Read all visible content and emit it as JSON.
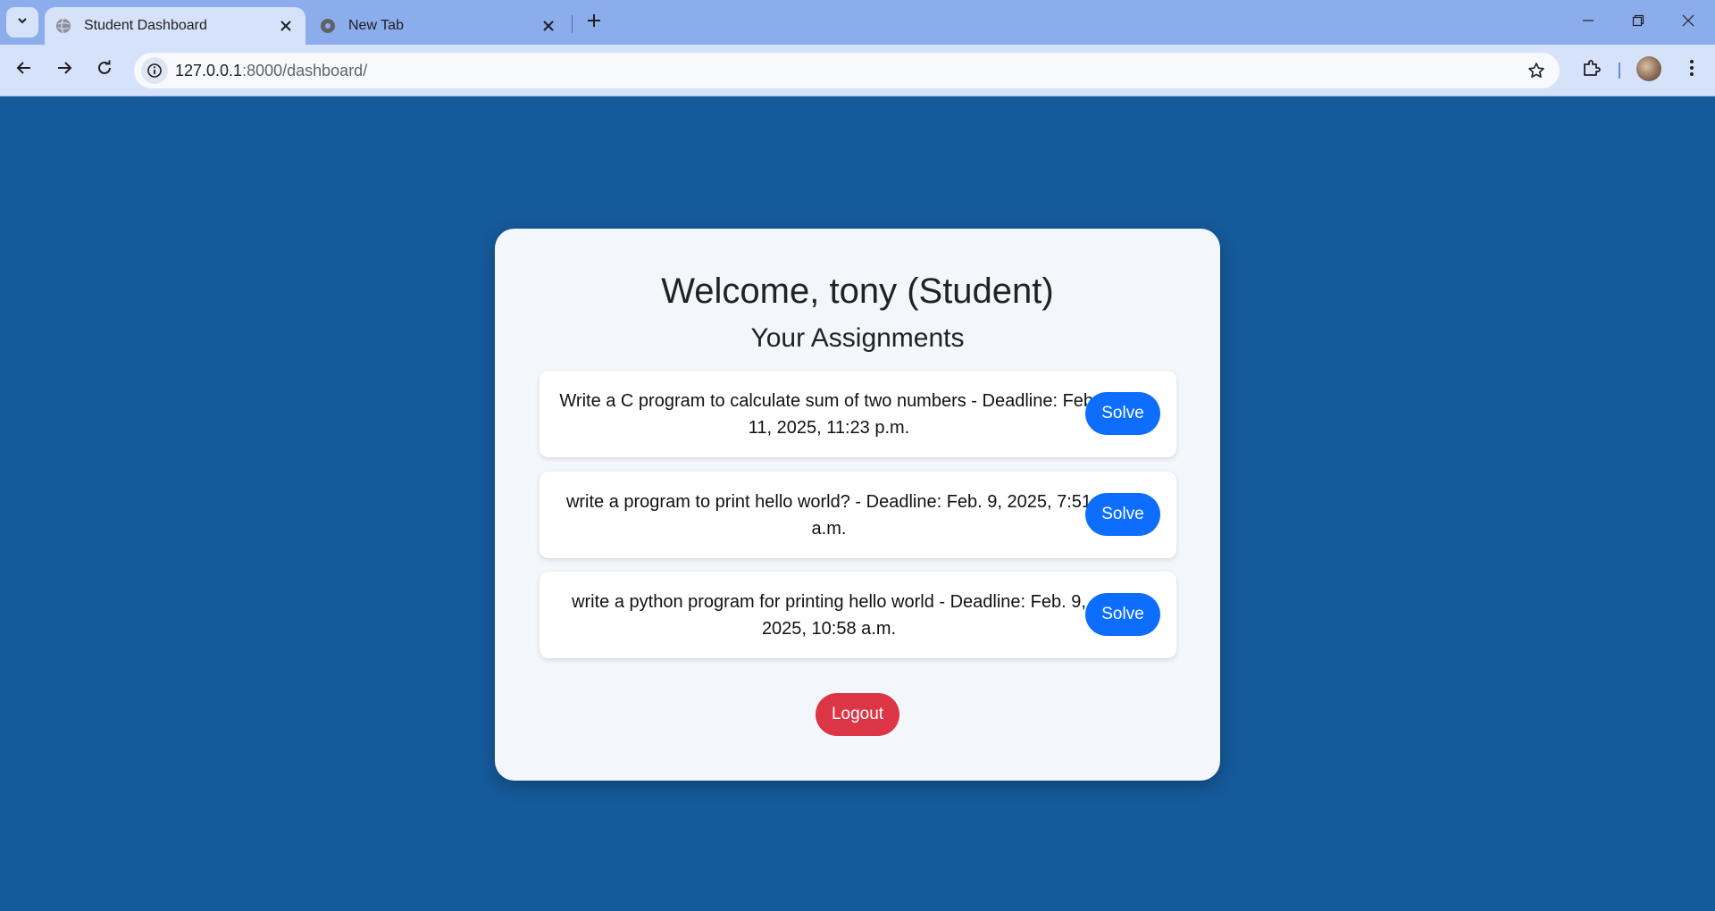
{
  "browser": {
    "tabs": [
      {
        "title": "Student Dashboard",
        "favicon": "globe-icon",
        "active": true
      },
      {
        "title": "New Tab",
        "favicon": "chrome-icon",
        "active": false
      }
    ],
    "url_host": "127.0.0.1",
    "url_rest": ":8000/dashboard/"
  },
  "page": {
    "welcome": "Welcome, tony (Student)",
    "assignments_title": "Your Assignments",
    "assignments": [
      {
        "text": "Write a C program to calculate sum of two numbers - Deadline: Feb. 11, 2025, 11:23 p.m.",
        "button": "Solve"
      },
      {
        "text": "write a program to print hello world? - Deadline: Feb. 9, 2025, 7:51 a.m.",
        "button": "Solve"
      },
      {
        "text": "write a python program for printing hello world - Deadline: Feb. 9, 2025, 10:58 a.m.",
        "button": "Solve"
      }
    ],
    "logout_label": "Logout"
  },
  "colors": {
    "page_background": "#155a9b",
    "card_background": "#f3f6fa",
    "solve_button": "#0d6efd",
    "logout_button": "#dc3545"
  }
}
